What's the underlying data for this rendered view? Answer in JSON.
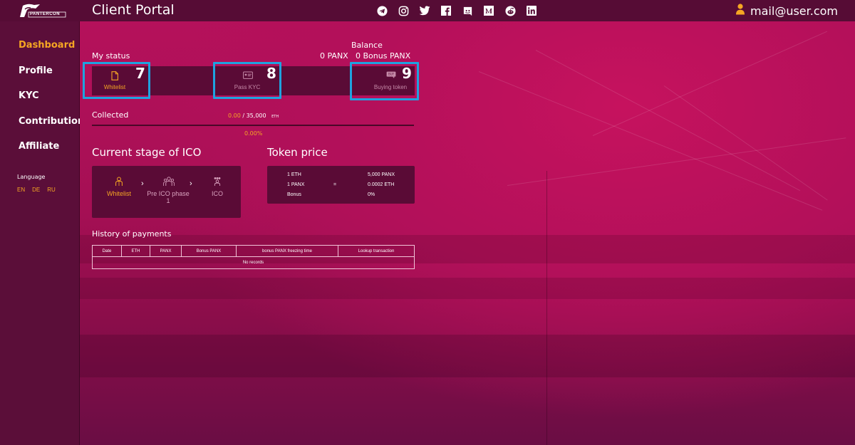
{
  "header": {
    "logo_text": "PANTERCON",
    "title": "Client Portal",
    "socials": [
      "telegram-icon",
      "instagram-icon",
      "twitter-icon",
      "facebook-icon",
      "discord-icon",
      "medium-icon",
      "reddit-icon",
      "linkedin-icon"
    ],
    "user_email": "mail@user.com"
  },
  "sidebar": {
    "items": [
      {
        "label": "Dashboard",
        "active": true
      },
      {
        "label": "Profile"
      },
      {
        "label": "KYC"
      },
      {
        "label": "Contribution"
      },
      {
        "label": "Affiliate"
      }
    ],
    "language_title": "Language",
    "languages": [
      "EN",
      "DE",
      "RU"
    ]
  },
  "status": {
    "title": "My status",
    "steps": [
      {
        "label": "Whitelist",
        "badge": "7",
        "active": true
      },
      {
        "label": "Pass KYC",
        "badge": "8"
      },
      {
        "label": "Buying token",
        "badge": "9"
      }
    ]
  },
  "balance": {
    "title": "Balance",
    "panx": "0 PANX",
    "bonus": "0 Bonus PANX"
  },
  "collected": {
    "label": "Collected",
    "amount": "0.00",
    "sep": " / 35,000",
    "unit": "ETH",
    "percent": "0.00%"
  },
  "stages": {
    "title": "Current stage of ICO",
    "items": [
      {
        "label": "Whitelist",
        "active": true
      },
      {
        "label": "Pre ICO phase 1"
      },
      {
        "label": "ICO"
      }
    ]
  },
  "token_price": {
    "title": "Token price",
    "rows": [
      {
        "left": "1 ETH",
        "mid": "",
        "right": "5,000 PANX"
      },
      {
        "left": "1 PANX",
        "mid": "=",
        "right": "0.0002 ETH"
      },
      {
        "left": "Bonus",
        "mid": "",
        "right": "0%"
      }
    ]
  },
  "history": {
    "title": "History of payments",
    "columns": [
      "Date",
      "ETH",
      "PANX",
      "Bonus PANX",
      "bonus PANX freezing time",
      "Lookup transaction"
    ],
    "empty": "No records"
  },
  "colors": {
    "accent": "#f5a623",
    "highlight": "#1fa3df",
    "panel": "#5a0b36",
    "sidebar": "#5b0e39"
  }
}
